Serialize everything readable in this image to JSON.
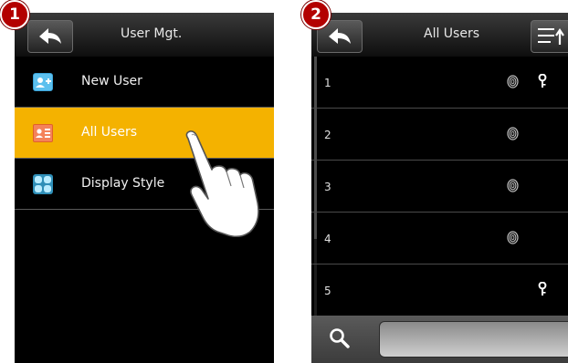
{
  "steps": {
    "first": "1",
    "second": "2"
  },
  "screen1": {
    "title": "User Mgt.",
    "back_icon": "back-arrow-icon",
    "menu": [
      {
        "label": "New User",
        "icon": "new-user-icon",
        "selected": false
      },
      {
        "label": "All Users",
        "icon": "all-users-icon",
        "selected": true
      },
      {
        "label": "Display Style",
        "icon": "display-style-icon",
        "selected": false
      }
    ],
    "selected_color": "#f4b200"
  },
  "screen2": {
    "title": "All Users",
    "back_icon": "back-arrow-icon",
    "sort_icon": "sort-list-icon",
    "search_icon": "magnifier-icon",
    "search_value": "",
    "users": [
      {
        "id": "1",
        "fingerprint": true,
        "password": true
      },
      {
        "id": "2",
        "fingerprint": true,
        "password": false
      },
      {
        "id": "3",
        "fingerprint": true,
        "password": false
      },
      {
        "id": "4",
        "fingerprint": true,
        "password": false
      },
      {
        "id": "5",
        "fingerprint": false,
        "password": true
      }
    ]
  }
}
